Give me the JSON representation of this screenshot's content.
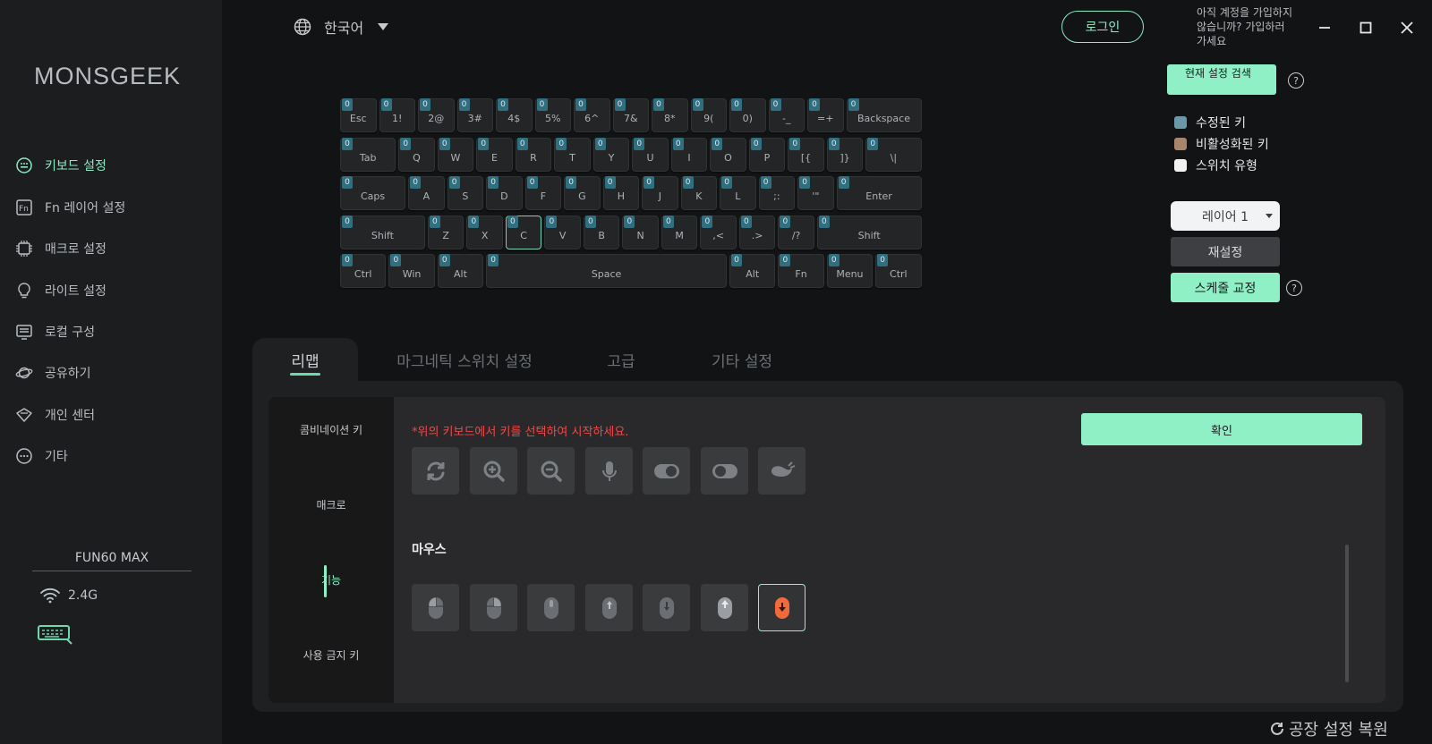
{
  "app": {
    "logo": "MONSGEEK"
  },
  "sidebar": {
    "items": [
      {
        "label": "키보드 설정",
        "icon": "keyboard-settings-icon"
      },
      {
        "label": "Fn 레이어 설정",
        "icon": "fn-layer-icon"
      },
      {
        "label": "매크로 설정",
        "icon": "macro-chip-icon"
      },
      {
        "label": "라이트 설정",
        "icon": "lightbulb-icon"
      },
      {
        "label": "로컬 구성",
        "icon": "local-config-icon"
      },
      {
        "label": "공유하기",
        "icon": "share-icon"
      },
      {
        "label": "개인 센터",
        "icon": "personal-center-icon"
      },
      {
        "label": "기타",
        "icon": "more-icon"
      }
    ],
    "device": {
      "name": "FUN60 MAX",
      "connection": "2.4G"
    }
  },
  "topbar": {
    "language": "한국어",
    "login": "로그인",
    "signup_prompt": "아직 계정을 가입하지 않습니까? 가입하러 가세요"
  },
  "keyboard": {
    "badge": "0",
    "rows": [
      [
        "Esc",
        "1!",
        "2@",
        "3#",
        "4$",
        "5%",
        "6^",
        "7&",
        "8*",
        "9(",
        "0)",
        "-_",
        "=+",
        "Backspace"
      ],
      [
        "Tab",
        "Q",
        "W",
        "E",
        "R",
        "T",
        "Y",
        "U",
        "I",
        "O",
        "P",
        "[{",
        "]}",
        "\\|"
      ],
      [
        "Caps",
        "A",
        "S",
        "D",
        "F",
        "G",
        "H",
        "J",
        "K",
        "L",
        ";:",
        "'\"",
        "Enter"
      ],
      [
        "Shift",
        "Z",
        "X",
        "C",
        "V",
        "B",
        "N",
        "M",
        ",<",
        ".>",
        "/?",
        "Shift"
      ],
      [
        "Ctrl",
        "Win",
        "Alt",
        "Space",
        "Alt",
        "Fn",
        "Menu",
        "Ctrl"
      ]
    ],
    "selected_key": "C"
  },
  "right_panel": {
    "search_button": "현재 설정 검색",
    "legend": [
      {
        "label": "수정된 키",
        "color": "#6a98a6"
      },
      {
        "label": "비활성화된 키",
        "color": "#a8866a"
      },
      {
        "label": "스위치 유형",
        "color": "#f2f2f2"
      }
    ],
    "layer": "레이어 1",
    "reset": "재설정",
    "schedule": "스케줄 교정"
  },
  "tabs": [
    "리맵",
    "마그네틱 스위치 설정",
    "고급",
    "기타 설정"
  ],
  "subnav": [
    "콤비네이션 키",
    "매크로",
    "기능",
    "사용 금지 키"
  ],
  "content": {
    "hint": "*위의 키보드에서 키를 선택하여 시작하세요.",
    "confirm": "확인",
    "function_icons": [
      "refresh-icon",
      "zoom-in-icon",
      "zoom-out-icon",
      "microphone-icon",
      "toggle-ios-icon",
      "toggle-ime-icon",
      "whale-icon"
    ],
    "mouse_label": "마우스",
    "mouse_icons": [
      "mouse-left-click-icon",
      "mouse-right-click-icon",
      "mouse-middle-click-icon",
      "mouse-scroll-up-icon",
      "mouse-scroll-down-icon",
      "mouse-forward-icon",
      "mouse-back-icon"
    ]
  },
  "footer": {
    "factory_reset": "공장 설정 복원"
  },
  "colors": {
    "accent": "#8ff0c6",
    "error": "#f04848",
    "selected_tile_accent": "#f26a3a"
  }
}
